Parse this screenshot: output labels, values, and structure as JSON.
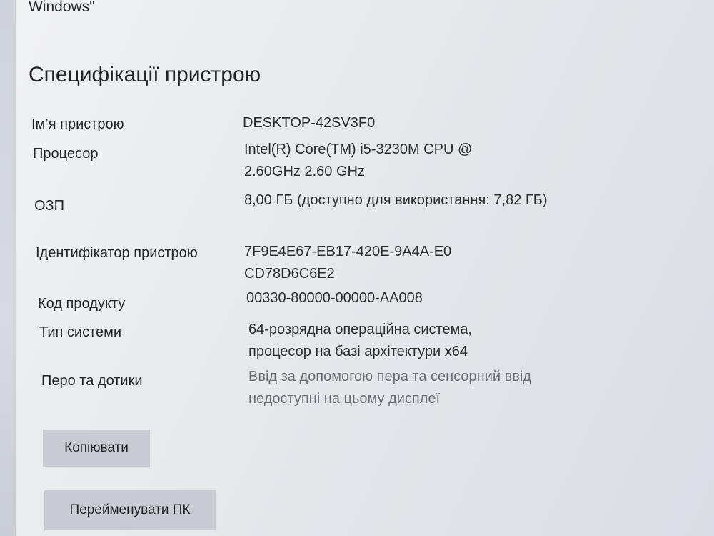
{
  "window": {
    "top_text": "Windows\""
  },
  "section": {
    "title": "Специфікації пристрою"
  },
  "specs": [
    {
      "label": "Ім’я пристрою",
      "value": "DESKTOP-42SV3F0"
    },
    {
      "label": "Процесор",
      "value": "Intel(R) Core(TM) i5-3230M CPU @ 2.60GHz   2.60 GHz"
    },
    {
      "label": "ОЗП",
      "value": "8,00 ГБ (доступно для використання: 7,82 ГБ)"
    },
    {
      "label": "Ідентифікатор пристрою",
      "value": "7F9E4E67-EB17-420E-9A4A-E0CD78D6C6E2"
    },
    {
      "label": "Код продукту",
      "value": "00330-80000-00000-AA008"
    },
    {
      "label": "Тип системи",
      "value": "64-розрядна операційна система, процесор на базі архітектури x64"
    },
    {
      "label": "Перо та дотики",
      "value": "Ввід за допомогою пера та сенсорний ввід недоступні на цьому дисплеї"
    }
  ],
  "buttons": {
    "copy_label": "Копіювати",
    "rename_label": "Перейменувати ПК"
  }
}
